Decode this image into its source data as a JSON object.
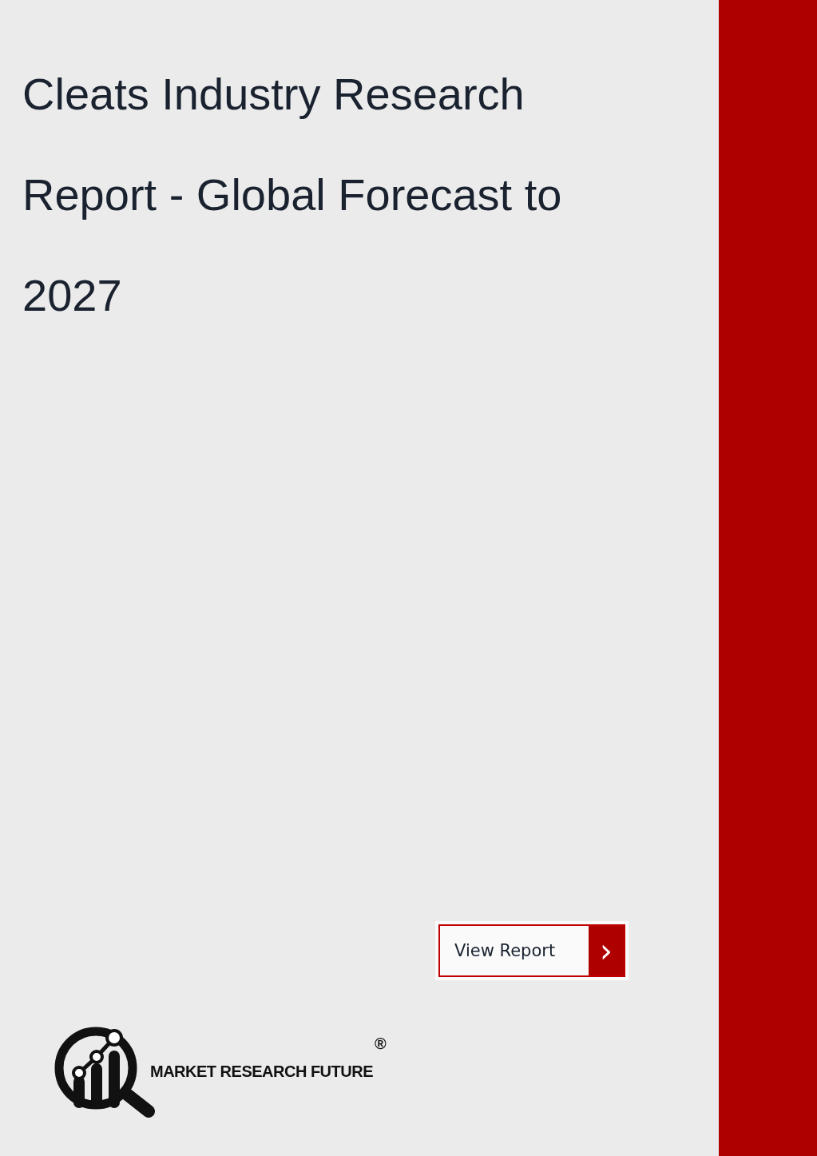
{
  "title": "Cleats Industry Research Report - Global Forecast to 2027",
  "button": {
    "label": "View Report",
    "icon": "›"
  },
  "logo": {
    "name": "MARKET RESEARCH FUTURE",
    "mark": "®"
  }
}
